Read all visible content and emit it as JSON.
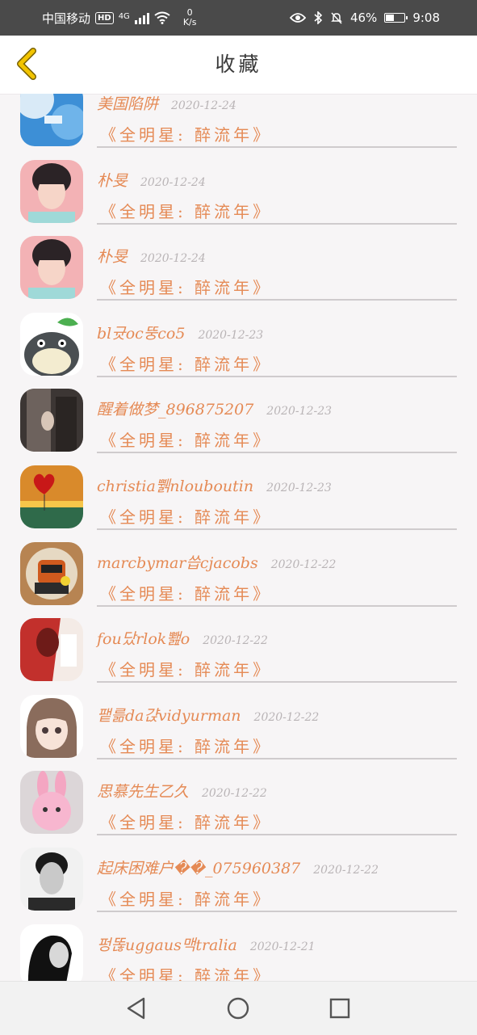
{
  "status_bar": {
    "carrier": "中国移动",
    "hd_badge": "HD",
    "network": "4G",
    "speed_value": "0",
    "speed_unit": "K/s",
    "battery": "46%",
    "time": "9:08",
    "battery_level": 0.46
  },
  "header": {
    "title": "收藏"
  },
  "items": [
    {
      "name": "美国陷阱",
      "date": "2020-12-24",
      "work": "《全明星: 醉流年》",
      "avatar": "sky-balloon-avatar"
    },
    {
      "name": "朴旻",
      "date": "2020-12-24",
      "work": "《全明星: 醉流年》",
      "avatar": "portrait-avatar"
    },
    {
      "name": "朴旻",
      "date": "2020-12-24",
      "work": "《全明星: 醉流年》",
      "avatar": "portrait-avatar"
    },
    {
      "name": "bl귯oc뚱co5",
      "date": "2020-12-23",
      "work": "《全明星: 醉流年》",
      "avatar": "totoro-avatar"
    },
    {
      "name": "醒着做梦_896875207",
      "date": "2020-12-23",
      "work": "《全明星: 醉流年》",
      "avatar": "dark-photo-avatar"
    },
    {
      "name": "christia쀍nlouboutin",
      "date": "2020-12-23",
      "work": "《全明星: 醉流年》",
      "avatar": "heart-sunset-avatar"
    },
    {
      "name": "marcbymar씁cjacobs",
      "date": "2020-12-22",
      "work": "《全明星: 醉流年》",
      "avatar": "cartoon-robot-avatar"
    },
    {
      "name": "fou닸rlok뾆o",
      "date": "2020-12-22",
      "work": "《全明星: 醉流年》",
      "avatar": "red-art-avatar"
    },
    {
      "name": "퍁륾da갽vidyurman",
      "date": "2020-12-22",
      "work": "《全明星: 醉流年》",
      "avatar": "anime-girl-avatar"
    },
    {
      "name": "思慕先生乙久",
      "date": "2020-12-22",
      "work": "《全明星: 醉流年》",
      "avatar": "pink-bunny-avatar"
    },
    {
      "name": "起床困难户��_075960387",
      "date": "2020-12-22",
      "work": "《全明星: 醉流年》",
      "avatar": "bw-portrait-avatar"
    },
    {
      "name": "펑똖uggaus맥tralia",
      "date": "2020-12-21",
      "work": "《全明星: 醉流年》",
      "avatar": "bw-silhouette-avatar"
    }
  ],
  "colors": {
    "accent": "#e58a55",
    "date": "#b9b4b6",
    "back_icon": "#e8b800",
    "background": "#f7f5f6"
  },
  "nav": {
    "back_icon": "triangle-back-icon",
    "home_icon": "circle-home-icon",
    "recents_icon": "square-recents-icon"
  }
}
